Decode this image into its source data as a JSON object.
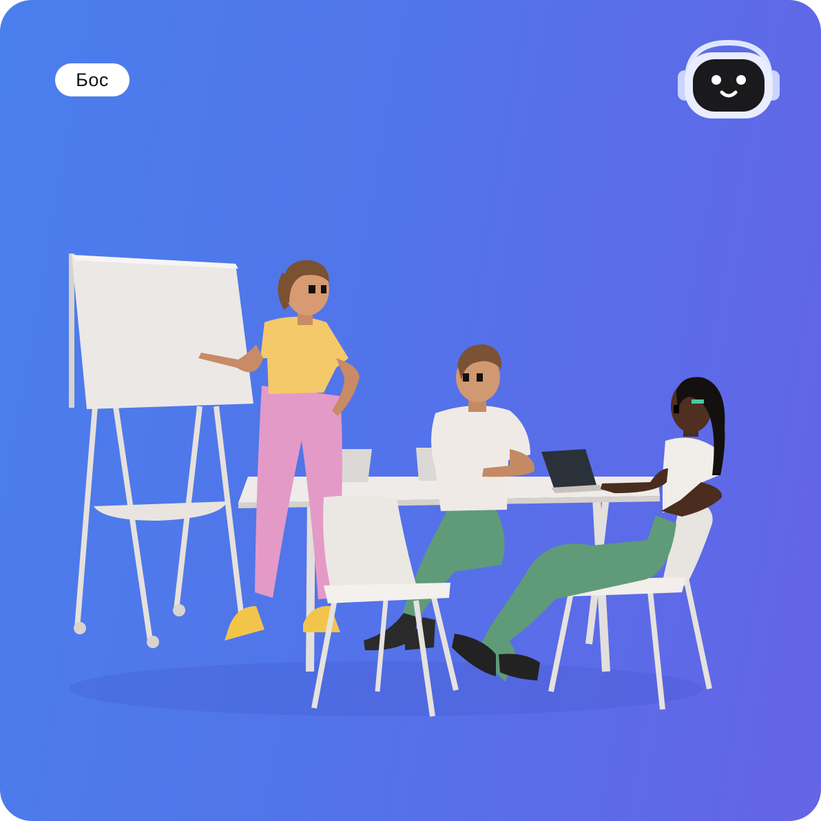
{
  "badge": {
    "label": "Бос"
  },
  "icons": {
    "logo": "robot-head-icon"
  },
  "colors": {
    "gradient_start": "#4a7fec",
    "gradient_end": "#6464e6",
    "badge_bg": "#ffffff",
    "robot_face": "#1a1a1c"
  }
}
